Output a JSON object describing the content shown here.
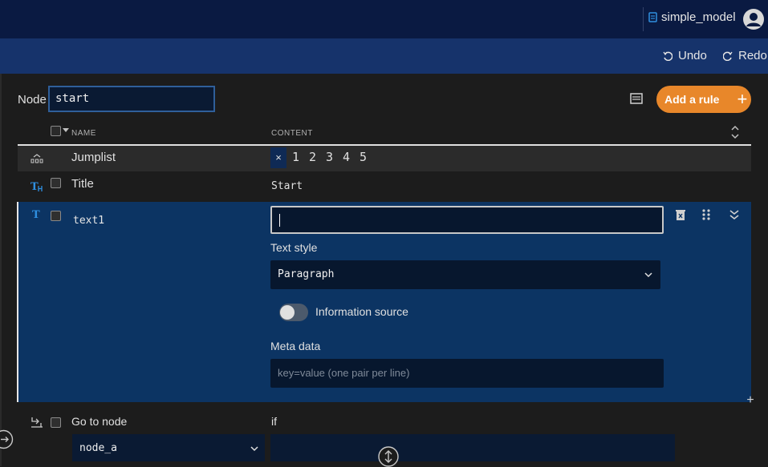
{
  "header": {
    "model_name": "simple_model"
  },
  "toolbar": {
    "undo_label": "Undo",
    "redo_label": "Redo"
  },
  "node": {
    "label": "Node",
    "value": "start"
  },
  "actions": {
    "add_rule_label": "Add a rule",
    "add_rule_icon": "+"
  },
  "columns": {
    "name": "NAME",
    "content": "CONTENT"
  },
  "rules": {
    "jumplist": {
      "label": "Jumplist",
      "clear": "×",
      "numbers": [
        "1",
        "2",
        "3",
        "4",
        "5"
      ]
    },
    "title": {
      "label": "Title",
      "value": "Start"
    },
    "text": {
      "name": "text1",
      "value": "",
      "text_style_label": "Text style",
      "text_style_value": "Paragraph",
      "info_source_label": "Information source",
      "info_source_on": false,
      "meta_label": "Meta data",
      "meta_placeholder": "key=value (one pair per line)",
      "add_after": "+"
    },
    "goto": {
      "label": "Go to node",
      "if_label": "if",
      "target": "node_a"
    }
  },
  "colors": {
    "topbar": "#0a1a42",
    "toolbar": "#16336b",
    "accent": "#e8872a",
    "selected_row": "#0c3463",
    "icon_blue": "#2f8fe0"
  }
}
